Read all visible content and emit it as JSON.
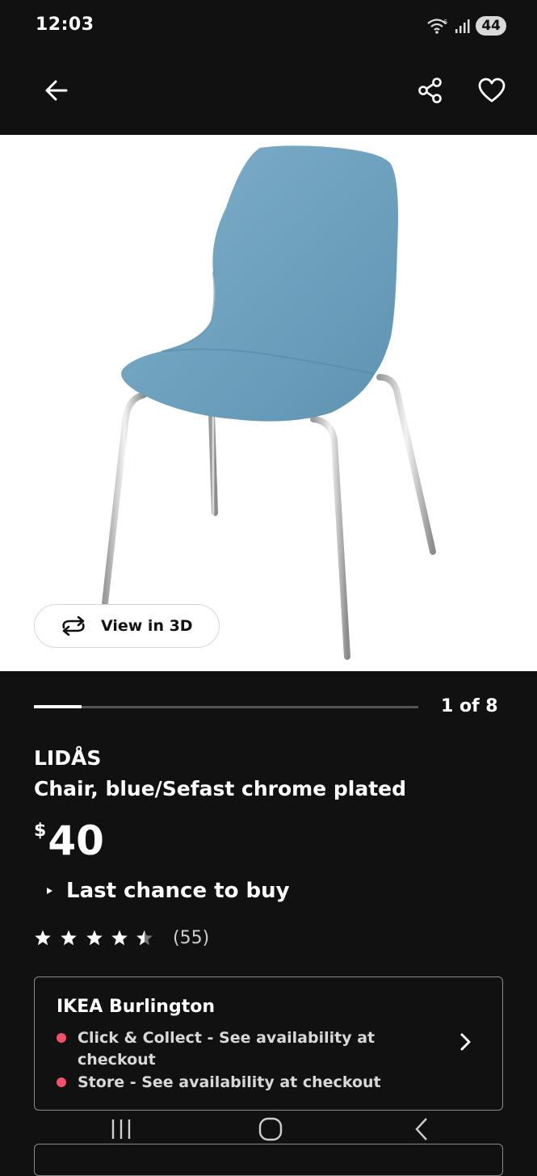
{
  "status_bar": {
    "time": "12:03",
    "battery": "44",
    "icons": [
      "wifi-icon",
      "signal-icon",
      "battery-icon"
    ]
  },
  "app_bar": {
    "icons": [
      "back-arrow-icon",
      "share-icon",
      "heart-icon"
    ]
  },
  "hero": {
    "view_in_3d_label": "View in 3D",
    "icon": "rotate-3d-icon"
  },
  "carousel": {
    "current": 1,
    "total": 8,
    "indicator_text": "1 of 8"
  },
  "product": {
    "brand": "LIDÅS",
    "description": "Chair, blue/Sefast chrome plated",
    "currency": "$",
    "price": "40",
    "notice": "Last chance to buy",
    "rating": 4.5,
    "rating_count": "(55)"
  },
  "store": {
    "name": "IKEA Burlington",
    "availability": [
      "Click & Collect - See availability at checkout",
      "Store - See availability at checkout"
    ],
    "status_color": "#f0516b"
  },
  "colors": {
    "background": "#111111",
    "chair_blue": "#6a9dba",
    "text": "#ffffff"
  },
  "nav_bar": {
    "icons": [
      "recent-apps-icon",
      "home-icon",
      "back-icon"
    ]
  }
}
